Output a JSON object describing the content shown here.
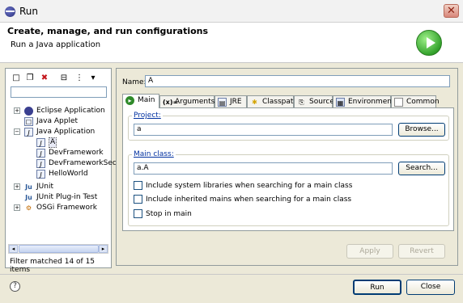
{
  "window": {
    "title": "Run"
  },
  "header": {
    "title": "Create, manage, and run configurations",
    "subtitle": "Run a Java application"
  },
  "left": {
    "filter_value": "",
    "tree": [
      {
        "label": "Eclipse Application",
        "icon": "eclipse-icon",
        "expander": "+"
      },
      {
        "label": "Java Applet",
        "icon": "applet-icon",
        "expander": ""
      },
      {
        "label": "Java Application",
        "icon": "java-app-icon",
        "expander": "−"
      },
      {
        "label": "A",
        "icon": "java-app-icon",
        "expander": ""
      },
      {
        "label": "DevFramework",
        "icon": "java-app-icon",
        "expander": ""
      },
      {
        "label": "DevFrameworkSec",
        "icon": "java-app-icon",
        "expander": ""
      },
      {
        "label": "HelloWorld",
        "icon": "java-app-icon",
        "expander": ""
      },
      {
        "label": "JUnit",
        "icon": "junit-icon",
        "expander": "+"
      },
      {
        "label": "JUnit Plug-in Test",
        "icon": "junit-plugin-icon",
        "expander": ""
      },
      {
        "label": "OSGi Framework",
        "icon": "osgi-icon",
        "expander": "+"
      }
    ],
    "status": "Filter matched 14 of 15 items"
  },
  "form": {
    "name_label": "Name:",
    "name_value": "A",
    "tabs": [
      {
        "label": "Main",
        "icon": "main-tab-icon"
      },
      {
        "label": "Arguments",
        "icon": "arguments-icon"
      },
      {
        "label": "JRE",
        "icon": "jre-icon"
      },
      {
        "label": "Classpath",
        "icon": "classpath-icon"
      },
      {
        "label": "Source",
        "icon": "source-icon"
      },
      {
        "label": "Environment",
        "icon": "environment-icon"
      },
      {
        "label": "Common",
        "icon": "common-icon"
      }
    ],
    "project_label": "Project:",
    "project_value": "a",
    "browse_label": "Browse...",
    "main_class_label": "Main class:",
    "main_class_value": "a.A",
    "search_label": "Search...",
    "checks": [
      {
        "label": "Include system libraries when searching for a main class",
        "checked": false
      },
      {
        "label": "Include inherited mains when searching for a main class",
        "checked": false
      },
      {
        "label": "Stop in main",
        "checked": false
      }
    ],
    "apply_label": "Apply",
    "revert_label": "Revert"
  },
  "footer": {
    "run_label": "Run",
    "close_label": "Close"
  }
}
